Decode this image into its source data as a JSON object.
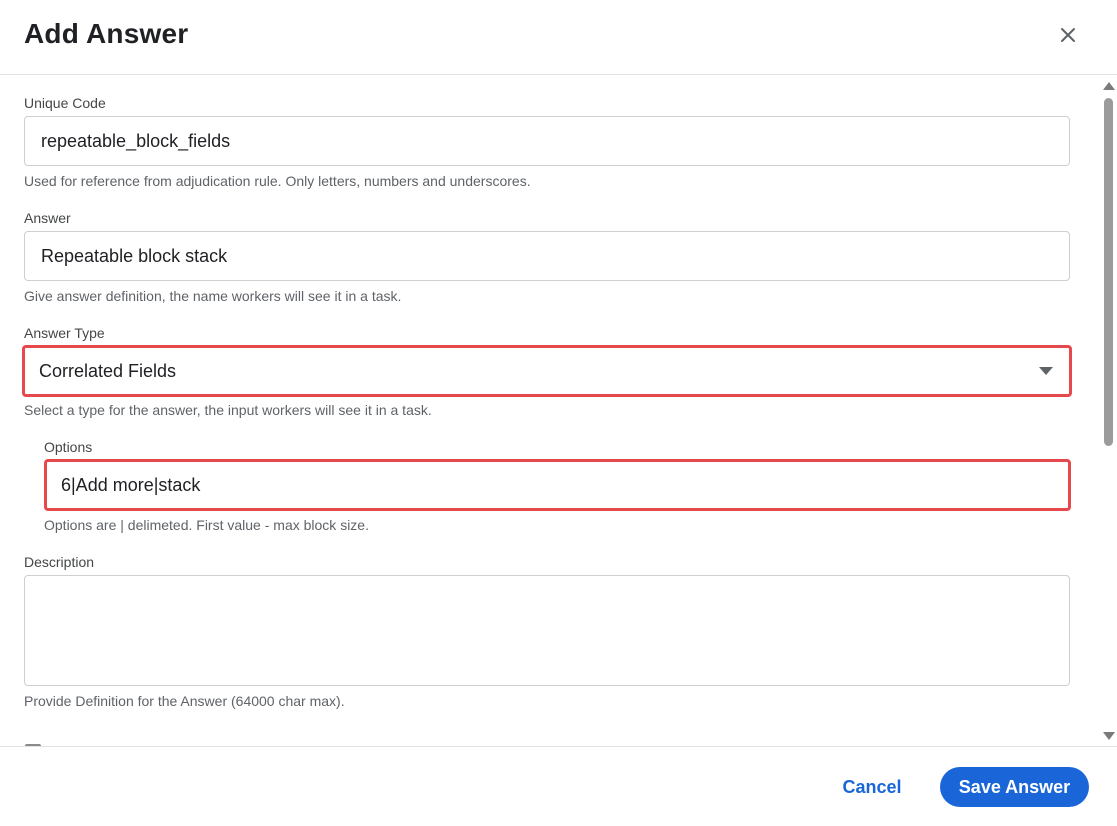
{
  "dialog": {
    "title": "Add Answer",
    "close_icon": "close-icon"
  },
  "form": {
    "unique_code": {
      "label": "Unique Code",
      "value": "repeatable_block_fields",
      "helper": "Used for reference from adjudication rule. Only letters, numbers and underscores."
    },
    "answer": {
      "label": "Answer",
      "value": "Repeatable block stack",
      "helper": "Give answer definition, the name workers will see it in a task."
    },
    "answer_type": {
      "label": "Answer Type",
      "selected": "Correlated Fields",
      "helper": "Select a type for the answer, the input workers will see it in a task."
    },
    "options": {
      "label": "Options",
      "value": "6|Add more|stack",
      "helper": "Options are | delimeted. First value - max block size."
    },
    "description": {
      "label": "Description",
      "value": "",
      "helper": "Provide Definition for the Answer (64000 char max)."
    }
  },
  "footer": {
    "cancel_label": "Cancel",
    "save_label": "Save Answer"
  },
  "colors": {
    "accent": "#1a66d9",
    "highlight_border": "#e5484d"
  }
}
